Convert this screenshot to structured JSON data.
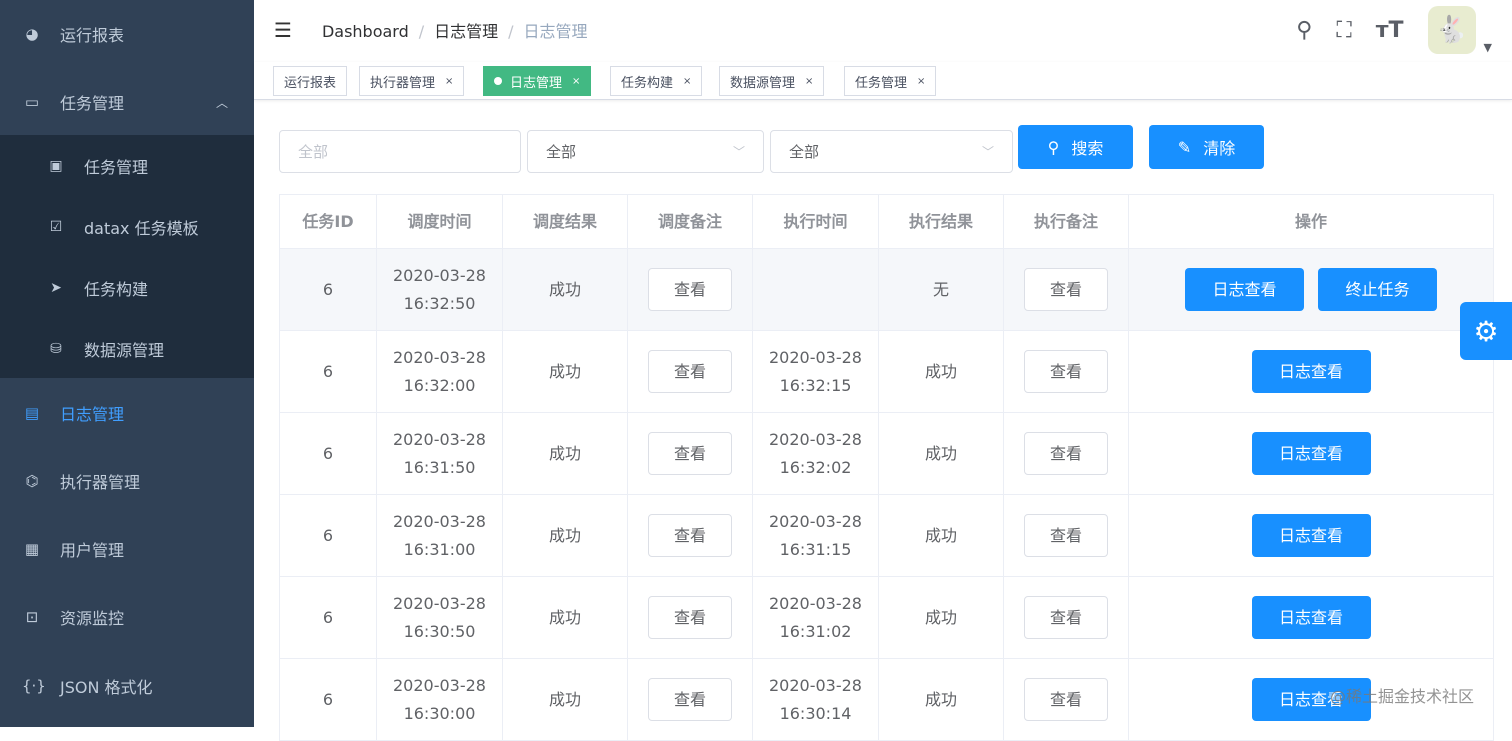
{
  "sidebar": {
    "items": [
      {
        "label": "运行报表",
        "icon": "dashboard-icon"
      },
      {
        "label": "任务管理",
        "icon": "monitor-icon",
        "expanded": true,
        "children": [
          {
            "label": "任务管理",
            "icon": "calendar-icon"
          },
          {
            "label": "datax 任务模板",
            "icon": "clipboard-icon"
          },
          {
            "label": "任务构建",
            "icon": "paper-plane-icon"
          },
          {
            "label": "数据源管理",
            "icon": "database-icon"
          }
        ]
      },
      {
        "label": "日志管理",
        "icon": "document-icon",
        "active": true
      },
      {
        "label": "执行器管理",
        "icon": "executor-icon"
      },
      {
        "label": "用户管理",
        "icon": "table-icon"
      },
      {
        "label": "资源监控",
        "icon": "monitor-resource-icon"
      },
      {
        "label": "JSON 格式化",
        "icon": "braces-icon"
      }
    ]
  },
  "breadcrumb": [
    "Dashboard",
    "日志管理",
    "日志管理"
  ],
  "tags": [
    {
      "label": "运行报表"
    },
    {
      "label": "执行器管理"
    },
    {
      "label": "日志管理",
      "active": true
    },
    {
      "label": "任务构建"
    },
    {
      "label": "数据源管理"
    },
    {
      "label": "任务管理"
    }
  ],
  "filters": {
    "placeholder": "全部",
    "select1": "全部",
    "select2": "全部",
    "search": "搜索",
    "clear": "清除"
  },
  "table": {
    "headers": [
      "任务ID",
      "调度时间",
      "调度结果",
      "调度备注",
      "执行时间",
      "执行结果",
      "执行备注",
      "操作"
    ],
    "view_label": "查看",
    "log_label": "日志查看",
    "kill_label": "终止任务",
    "rows": [
      {
        "id": "6",
        "sd": "2020-03-28",
        "st": "16:32:50",
        "sr": "成功",
        "ed": "",
        "et": "",
        "er": "无",
        "kill": true
      },
      {
        "id": "6",
        "sd": "2020-03-28",
        "st": "16:32:00",
        "sr": "成功",
        "ed": "2020-03-28",
        "et": "16:32:15",
        "er": "成功"
      },
      {
        "id": "6",
        "sd": "2020-03-28",
        "st": "16:31:50",
        "sr": "成功",
        "ed": "2020-03-28",
        "et": "16:32:02",
        "er": "成功"
      },
      {
        "id": "6",
        "sd": "2020-03-28",
        "st": "16:31:00",
        "sr": "成功",
        "ed": "2020-03-28",
        "et": "16:31:15",
        "er": "成功"
      },
      {
        "id": "6",
        "sd": "2020-03-28",
        "st": "16:30:50",
        "sr": "成功",
        "ed": "2020-03-28",
        "et": "16:31:02",
        "er": "成功"
      },
      {
        "id": "6",
        "sd": "2020-03-28",
        "st": "16:30:00",
        "sr": "成功",
        "ed": "2020-03-28",
        "et": "16:30:14",
        "er": "成功"
      }
    ]
  },
  "watermark": "@稀土掘金技术社区",
  "colors": {
    "sidebar": "#304156",
    "submenu": "#1f2d3d",
    "primary": "#1890ff",
    "activeTag": "#42b983"
  }
}
